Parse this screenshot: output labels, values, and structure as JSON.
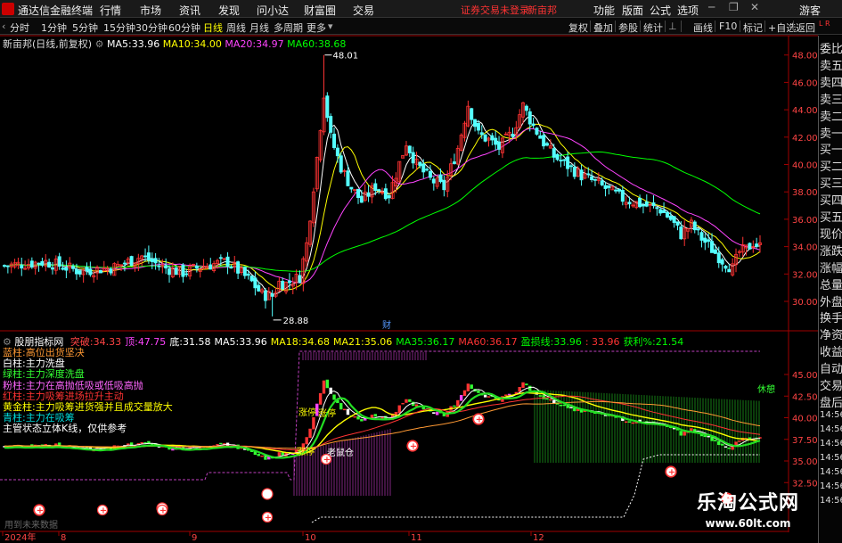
{
  "titlebar": {
    "app_name": "通达信金融终端",
    "menu": [
      "行情",
      "市场",
      "资讯",
      "发现",
      "问小达",
      "财富圈",
      "交易"
    ],
    "warning": "证券交易未登录",
    "stock_name": "新亩邦",
    "right_menu": [
      "功能",
      "版面",
      "公式",
      "选项"
    ],
    "guest": "游客"
  },
  "toolbar": {
    "periods": [
      "分时",
      "1分钟",
      "5分钟",
      "15分钟",
      "30分钟",
      "60分钟",
      "日线",
      "周线",
      "月线",
      "多周期",
      "更多"
    ],
    "active_period": "日线",
    "right_buttons": [
      "复权",
      "叠加",
      "参股",
      "统计",
      "画线",
      "F10",
      "标记",
      "+自选",
      "返回"
    ]
  },
  "main_chart": {
    "header": "新亩邦(日线,前复权)",
    "ma": [
      {
        "label": "MA5:",
        "value": "33.96",
        "color": "#ffffff"
      },
      {
        "label": "MA10:",
        "value": "34.00",
        "color": "#ffff00"
      },
      {
        "label": "MA20:",
        "value": "34.97",
        "color": "#ff44ff"
      },
      {
        "label": "MA60:",
        "value": "38.68",
        "color": "#00ff00"
      }
    ],
    "y_ticks": [
      "48.00",
      "46.00",
      "44.00",
      "42.00",
      "40.00",
      "38.00",
      "36.00",
      "34.00",
      "32.00",
      "30.00"
    ],
    "high_label": "48.01",
    "low_label": "28.88",
    "cai_mark": "财"
  },
  "indicator": {
    "header": "股朋指标网",
    "values": [
      {
        "label": "突破:",
        "value": "34.33",
        "color": "#ff4444"
      },
      {
        "label": "顶:",
        "value": "47.75",
        "color": "#ff44ff"
      },
      {
        "label": "底:",
        "value": "31.58",
        "color": "#ffffff"
      },
      {
        "label": "MA5:",
        "value": "33.96",
        "color": "#ffffff"
      },
      {
        "label": "MA18:",
        "value": "34.68",
        "color": "#ffff00"
      },
      {
        "label": "MA21:",
        "value": "35.06",
        "color": "#ffff00"
      },
      {
        "label": "MA35:",
        "value": "36.17",
        "color": "#00ff00"
      },
      {
        "label": "MA60:",
        "value": "36.17",
        "color": "#ff3333"
      },
      {
        "label": "盈损线:",
        "value": "33.96",
        "color": "#00ff00"
      },
      {
        "label": "",
        "value": ": 33.96",
        "color": "#ff3333"
      },
      {
        "label": "获利%:",
        "value": "21.54",
        "color": "#00ff00"
      }
    ],
    "legend": [
      {
        "text": "蓝柱:高位出货坚决",
        "color": "#ff9933"
      },
      {
        "text": "白柱:主力洗盘",
        "color": "#ffffff"
      },
      {
        "text": "绿柱:主力深度洗盘",
        "color": "#33ff33"
      },
      {
        "text": "粉柱:主力在高抛低吸或低吸高抛",
        "color": "#ff66ff"
      },
      {
        "text": "红柱:主力吸筹进场拉升主动",
        "color": "#ff3333"
      },
      {
        "text": "黄金柱:主力吸筹进货强并且成交量放大",
        "color": "#ffff00"
      },
      {
        "text": "青柱:主力在吸筹",
        "color": "#00dddd"
      },
      {
        "text": "主管状态立体K线，仅供参考",
        "color": "#ffffff"
      }
    ],
    "y_ticks": [
      "45.00",
      "42.50",
      "40.00",
      "37.50",
      "35.00",
      "32.50"
    ],
    "annotations": [
      "涨停",
      "涨停",
      "涨停",
      "老鼠仓",
      "休憩"
    ],
    "footer": "用到未来数据"
  },
  "date_axis": {
    "labels": [
      "2024年",
      "8",
      "9",
      "10",
      "11",
      "12"
    ]
  },
  "right_panel": {
    "items": [
      "委比",
      "卖五",
      "卖四",
      "卖三",
      "卖二",
      "卖一",
      "买一",
      "买二",
      "买三",
      "买四",
      "买五",
      "现价",
      "涨跌",
      "涨幅",
      "总量",
      "外盘",
      "换手",
      "净资",
      "收益",
      "自动",
      "交易",
      "盘后",
      "14:56",
      "14:56",
      "14:56",
      "14:56",
      "14:56",
      "14:56",
      "14:56"
    ]
  },
  "watermark": {
    "line1": "乐淘公式网",
    "line2": "www.60lt.com"
  },
  "colors": {
    "up": "#ff3333",
    "down": "#54ffff",
    "ma5": "#ffffff",
    "ma10": "#ffff00",
    "ma20": "#ff44ff",
    "ma60": "#00ff00",
    "axis": "#a00000"
  }
}
